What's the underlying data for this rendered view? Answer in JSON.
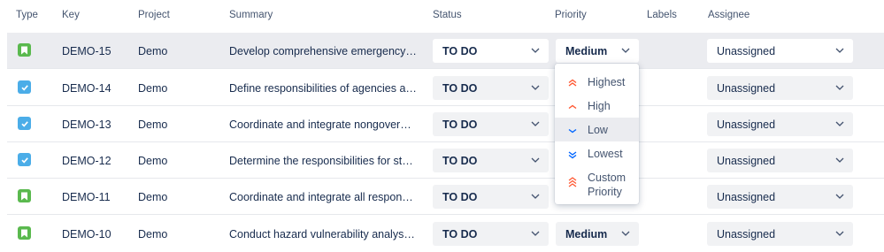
{
  "headers": {
    "type": "Type",
    "key": "Key",
    "project": "Project",
    "summary": "Summary",
    "status": "Status",
    "priority": "Priority",
    "labels": "Labels",
    "assignee": "Assignee"
  },
  "colors": {
    "story": "#5ab94e",
    "task": "#4bade8",
    "priority_high": "#ff5630",
    "priority_low": "#0065ff"
  },
  "rows": [
    {
      "type": "story",
      "key": "DEMO-15",
      "project": "Demo",
      "summary": "Develop comprehensive emergency management plan",
      "status": "TO DO",
      "priority": "Medium",
      "assignee": "Unassigned"
    },
    {
      "type": "task",
      "key": "DEMO-14",
      "project": "Demo",
      "summary": "Define responsibilities of agencies and departments",
      "status": "TO DO",
      "priority": "",
      "assignee": "Unassigned"
    },
    {
      "type": "task",
      "key": "DEMO-13",
      "project": "Demo",
      "summary": "Coordinate and integrate nongovernmental resources",
      "status": "TO DO",
      "priority": "",
      "assignee": "Unassigned"
    },
    {
      "type": "task",
      "key": "DEMO-12",
      "project": "Demo",
      "summary": "Determine the responsibilities for standards",
      "status": "TO DO",
      "priority": "",
      "assignee": "Unassigned"
    },
    {
      "type": "story",
      "key": "DEMO-11",
      "project": "Demo",
      "summary": "Coordinate and integrate all response and recovery",
      "status": "TO DO",
      "priority": "",
      "assignee": "Unassigned"
    },
    {
      "type": "story",
      "key": "DEMO-10",
      "project": "Demo",
      "summary": "Conduct hazard vulnerability analysis to identify risks",
      "status": "TO DO",
      "priority": "Medium",
      "assignee": "Unassigned"
    }
  ],
  "priority_menu": {
    "items": [
      {
        "label": "Highest",
        "icon": "priority-highest-icon"
      },
      {
        "label": "High",
        "icon": "priority-high-icon"
      },
      {
        "label": "Low",
        "icon": "priority-low-icon"
      },
      {
        "label": "Lowest",
        "icon": "priority-lowest-icon"
      },
      {
        "label": "Custom Priority",
        "icon": "priority-custom-icon"
      }
    ],
    "highlighted": "Low"
  }
}
